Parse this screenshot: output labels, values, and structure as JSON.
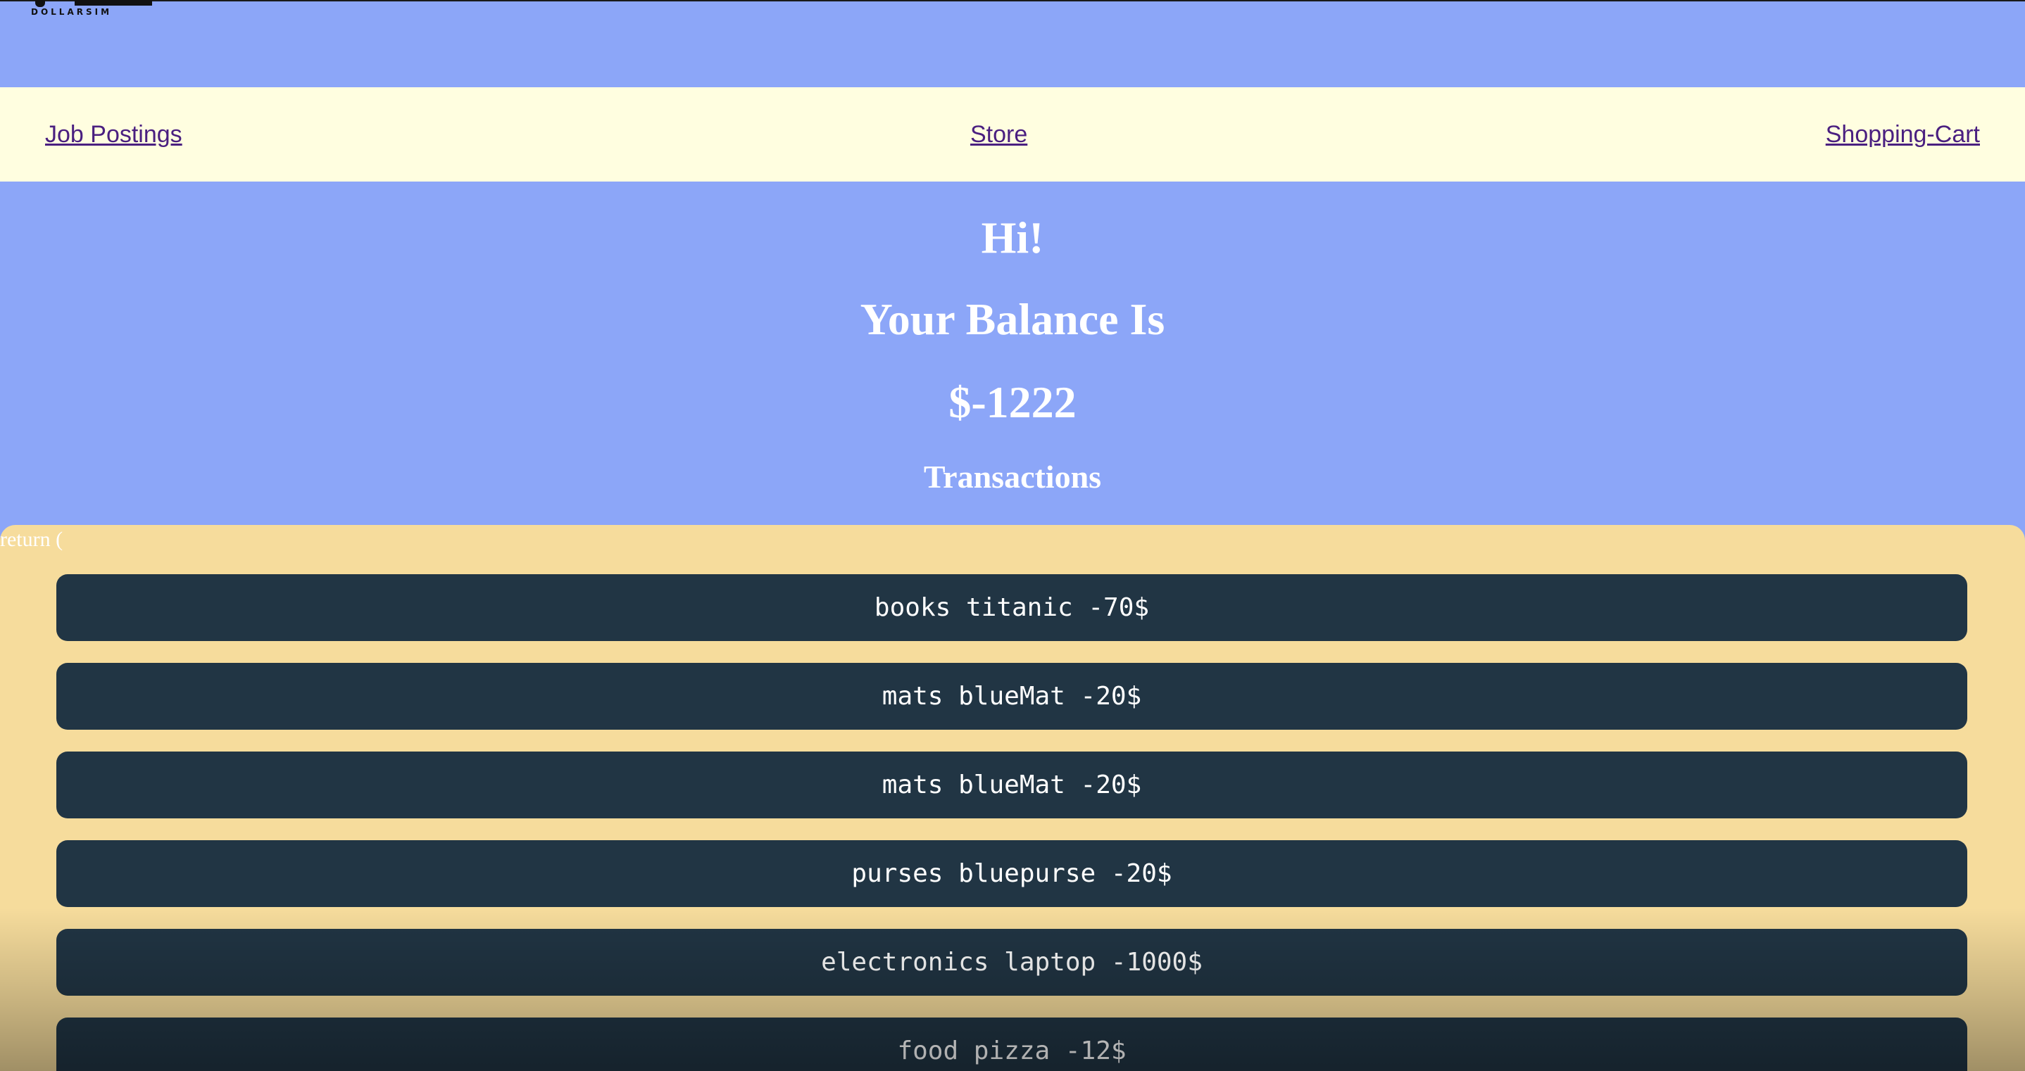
{
  "logo": {
    "text": "DOLLARSIM"
  },
  "nav": {
    "job_postings": "Job Postings",
    "store": "Store",
    "shopping_cart": "Shopping-Cart"
  },
  "header": {
    "greeting": "Hi!",
    "balance_label": "Your Balance Is",
    "balance": "$-1222",
    "transactions_title": "Transactions"
  },
  "panel": {
    "return_text": "return ("
  },
  "transactions": [
    {
      "text": "books titanic -70$"
    },
    {
      "text": "mats blueMat -20$"
    },
    {
      "text": "mats blueMat -20$"
    },
    {
      "text": "purses bluepurse -20$"
    },
    {
      "text": "electronics laptop -1000$"
    },
    {
      "text": "food pizza -12$"
    }
  ],
  "colors": {
    "background": "#8ca6f8",
    "navbar": "#fffee0",
    "link": "#4a1f80",
    "panel": "#f6dc9c",
    "transaction_row": "#213544",
    "text_light": "#ffffff"
  }
}
